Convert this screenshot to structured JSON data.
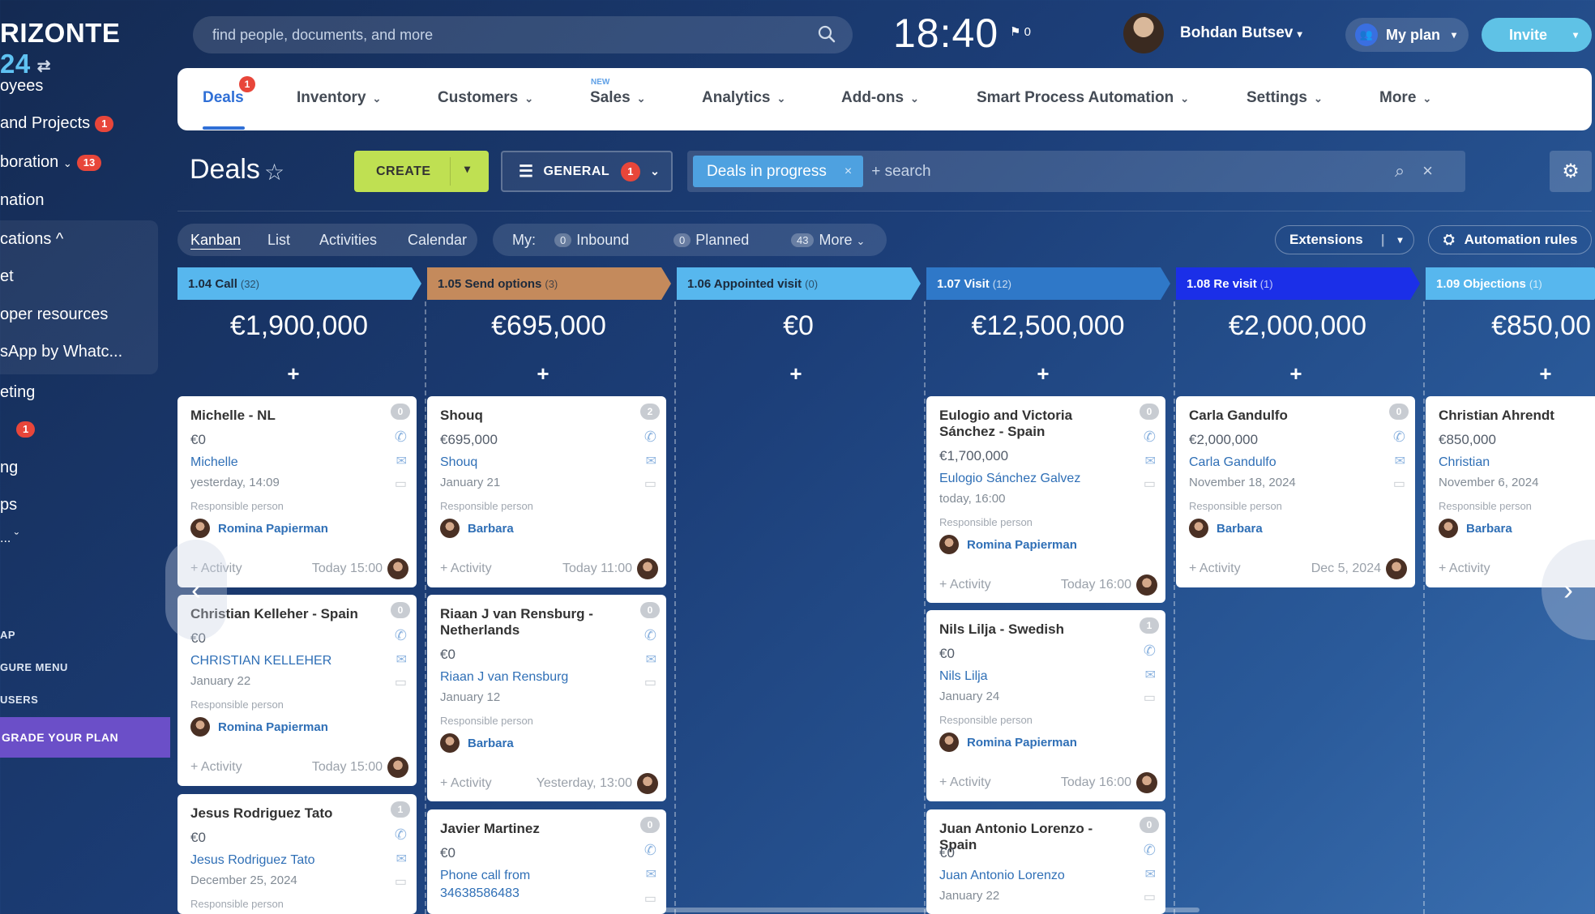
{
  "sidebar": {
    "logo_text": "RIZONTE",
    "logo_num": "24",
    "items": [
      {
        "label": "oyees"
      },
      {
        "label": " and Projects",
        "badge": "1"
      },
      {
        "label": "boration",
        "badge": "13"
      },
      {
        "label": "nation"
      },
      {
        "label": "cations ^"
      },
      {
        "label": "et"
      },
      {
        "label": "oper resources"
      },
      {
        "label": "sApp by Whatc..."
      },
      {
        "label": "eting"
      },
      {
        "label": "ng"
      },
      {
        "label": "ps"
      },
      {
        "label": "... ˇ"
      },
      {
        "label": "AP"
      },
      {
        "label": "GURE MENU"
      },
      {
        "label": "USERS"
      }
    ],
    "unnamed_badge": "1",
    "upgrade": "GRADE YOUR PLAN"
  },
  "topbar": {
    "search_placeholder": "find people, documents, and more",
    "clock": "18:40",
    "flag_count": "0",
    "user_name": "Bohdan Butsev",
    "myplan": "My plan",
    "invite": "Invite"
  },
  "nav": {
    "deals": "Deals",
    "deals_badge": "1",
    "new_label": "NEW",
    "items": [
      "Inventory",
      "Customers",
      "Sales",
      "Analytics",
      "Add-ons",
      "Smart Process Automation",
      "Settings",
      "More"
    ]
  },
  "toolbar": {
    "title": "Deals",
    "create": "CREATE",
    "general": "GENERAL",
    "general_badge": "1",
    "filter_tag": "Deals in progress",
    "search_placeholder": "search",
    "search_prefix": "+"
  },
  "view_tabs": [
    "Kanban",
    "List",
    "Activities",
    "Calendar"
  ],
  "my_bar": {
    "label": "My:",
    "inbound_count": "0",
    "inbound": "Inbound",
    "planned_count": "0",
    "planned": "Planned",
    "more_count": "43",
    "more": "More"
  },
  "extensions": "Extensions",
  "automation": "Automation rules",
  "columns": [
    {
      "name": "1.04 Call",
      "count": "(32)",
      "color": "#57b7ee",
      "sum": "€1,900,000"
    },
    {
      "name": "1.05 Send options",
      "count": "(3)",
      "color": "#c48a5c",
      "sum": "€695,000"
    },
    {
      "name": "1.06 Appointed visit",
      "count": "(0)",
      "color": "#57b7ee",
      "sum": "€0"
    },
    {
      "name": "1.07 Visit",
      "count": "(12)",
      "color": "#2f78c8",
      "sum": "€12,500,000"
    },
    {
      "name": "1.08 Re visit",
      "count": "(1)",
      "color": "#1b2fe8",
      "sum": "€2,000,000"
    },
    {
      "name": "1.09 Objections",
      "count": "(1)",
      "color": "#57b7ee",
      "sum": "€850,00"
    }
  ],
  "plus": "+",
  "resp_label": "Responsible person",
  "activity_label": "+ Activity",
  "cards": {
    "c1": {
      "title": "Michelle - NL",
      "count": "0",
      "amount": "€0",
      "contact": "Michelle",
      "date": "yesterday, 14:09",
      "person": "Romina Papierman",
      "act_date": "Today 15:00"
    },
    "c2": {
      "title": "Christian Kelleher - Spain",
      "count": "0",
      "amount": "€0",
      "contact": "CHRISTIAN KELLEHER",
      "date": "January 22",
      "person": "Romina Papierman",
      "act_date": "Today 15:00"
    },
    "c3": {
      "title": "Jesus Rodriguez Tato",
      "count": "1",
      "amount": "€0",
      "contact": "Jesus Rodriguez Tato",
      "date": "December 25, 2024",
      "resp": "Responsible person"
    },
    "c4": {
      "title": "Shouq",
      "count": "2",
      "amount": "€695,000",
      "contact": "Shouq",
      "date": "January 21",
      "person": "Barbara",
      "act_date": "Today 11:00"
    },
    "c5": {
      "title": "Riaan J van Rensburg - Netherlands",
      "count": "0",
      "amount": "€0",
      "contact": "Riaan J van Rensburg",
      "date": "January 12",
      "person": "Barbara",
      "act_date": "Yesterday, 13:00"
    },
    "c6": {
      "title": "Javier Martinez",
      "count": "0",
      "amount": "€0",
      "contact": "Phone call from 34638586483"
    },
    "c7": {
      "title": "Eulogio and Victoria Sánchez - Spain",
      "count": "0",
      "amount": "€1,700,000",
      "contact": "Eulogio Sánchez Galvez",
      "date": "today, 16:00",
      "person": "Romina Papierman",
      "act_date": "Today 16:00"
    },
    "c8": {
      "title": "Nils Lilja - Swedish",
      "count": "1",
      "amount": "€0",
      "contact": "Nils Lilja",
      "date": "January 24",
      "person": "Romina Papierman",
      "act_date": "Today 16:00"
    },
    "c9": {
      "title": "Juan Antonio Lorenzo - Spain",
      "count": "0",
      "amount": "€0",
      "contact": "Juan Antonio Lorenzo",
      "date": "January 22"
    },
    "c10": {
      "title": "Carla Gandulfo",
      "count": "0",
      "amount": "€2,000,000",
      "contact": "Carla Gandulfo",
      "date": "November 18, 2024",
      "person": "Barbara",
      "act_date": "Dec 5, 2024"
    },
    "c11": {
      "title": "Christian Ahrendt",
      "amount": "€850,000",
      "contact": "Christian",
      "date": "November 6, 2024",
      "person": "Barbara"
    }
  }
}
